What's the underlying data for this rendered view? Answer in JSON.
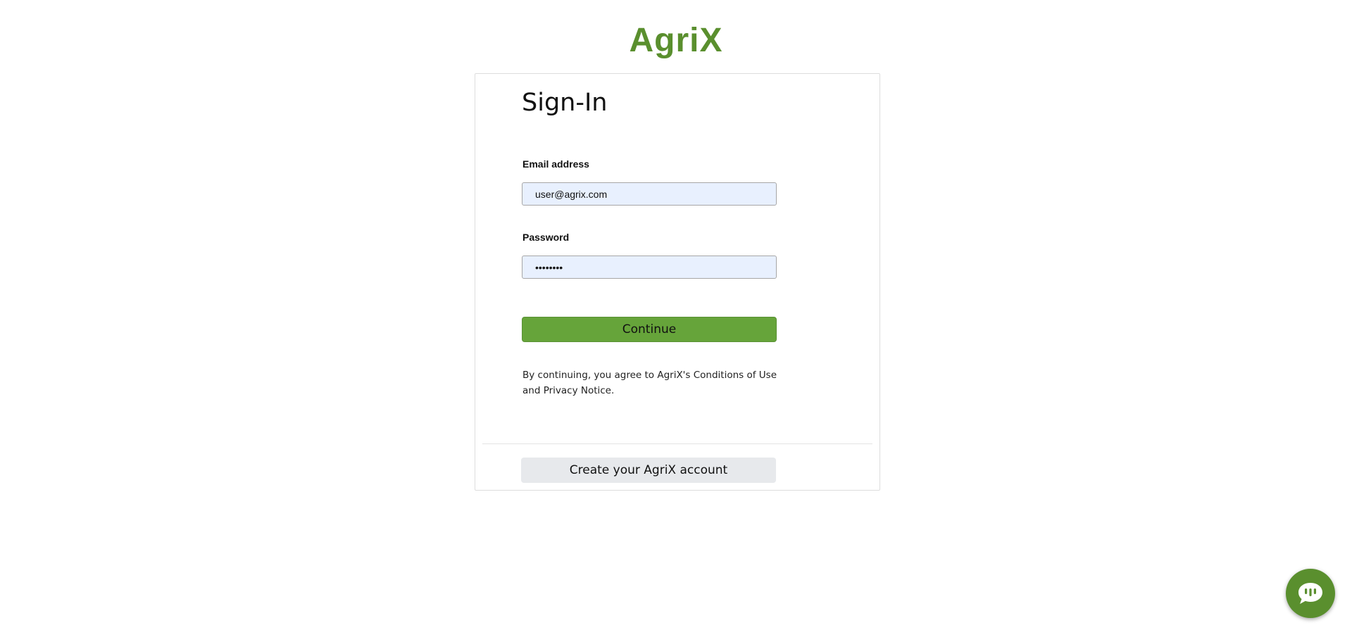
{
  "brand": {
    "logo_text": "AgriX",
    "accent_color": "#5a8f2e",
    "button_color": "#66a43a"
  },
  "signin": {
    "title": "Sign-In",
    "email_label": "Email address",
    "email_value": "user@agrix.com",
    "password_label": "Password",
    "password_value": "password",
    "continue_label": "Continue",
    "legal_text": "By continuing, you agree to AgriX's Conditions of Use and Privacy Notice."
  },
  "footer": {
    "create_account_label": "Create your AgriX account"
  },
  "chat": {
    "icon": "chat-bubble-icon",
    "color": "#5a8f2e"
  },
  "input_background": "#e8f0fe"
}
